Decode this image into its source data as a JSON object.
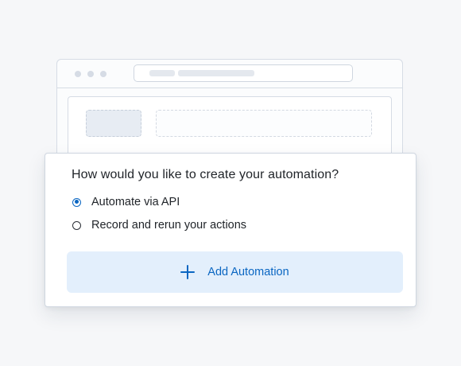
{
  "dialog": {
    "question": "How would you like to create your automation?",
    "options": [
      {
        "label": "Automate via API",
        "selected": true
      },
      {
        "label": "Record and rerun your actions",
        "selected": false
      }
    ],
    "add_button_label": "Add Automation",
    "add_button_icon": "plus-icon"
  },
  "colors": {
    "accent": "#0a66c2",
    "button_background": "#e3effc"
  }
}
